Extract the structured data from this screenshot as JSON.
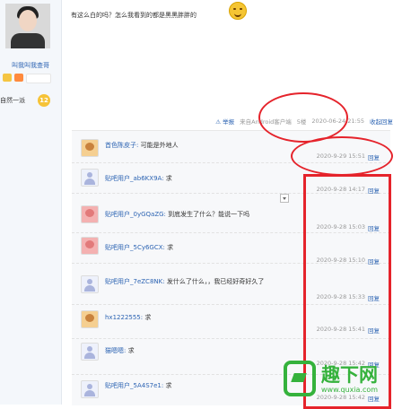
{
  "sidebar": {
    "username": "叫我叫我查哥",
    "level_name": "自然一派",
    "level": "12"
  },
  "post": {
    "text": "有这么白的吗？怎么我看到的都是黑黑胖胖的",
    "report": "⚠ 举报",
    "source": "来自Android客户端",
    "floor": "5楼",
    "time": "2020-06-24 21:55",
    "collapse": "收起回复"
  },
  "comments": [
    {
      "user": "首色陈皮子:",
      "content": "可能是外地人",
      "time": "2020-9-29 15:51",
      "reply": "回复",
      "avatar": "bear"
    },
    {
      "user": "贴吧用户_ab6KX9A:",
      "content": "求",
      "time": "2020-9-28 14:17",
      "reply": "回复",
      "avatar": "default"
    },
    {
      "user": "贴吧用户_0yGQaZG:",
      "content": "到底发生了什么？能说一下吗",
      "time": "2020-9-28 15:03",
      "reply": "回复",
      "avatar": "pink"
    },
    {
      "user": "贴吧用户_5Cy6GCX:",
      "content": "求",
      "time": "2020-9-28 15:10",
      "reply": "回复",
      "avatar": "pink"
    },
    {
      "user": "贴吧用户_7eZC8NK:",
      "content": "发什么了什么，，我已经好奇好久了",
      "time": "2020-9-28 15:33",
      "reply": "回复",
      "avatar": "default"
    },
    {
      "user": "hx1222555:",
      "content": "求",
      "time": "2020-9-28 15:41",
      "reply": "回复",
      "avatar": "bear"
    },
    {
      "user": "猫嗯嗯:",
      "content": "求",
      "time": "2020-9-28 15:42",
      "reply": "回复",
      "avatar": "default"
    },
    {
      "user": "贴吧用户_5A4S7e1:",
      "content": "求",
      "time": "2020-9-28 15:42",
      "reply": "回复",
      "avatar": "default"
    }
  ],
  "watermark": {
    "text": "趣下网",
    "url": "www.quxia.com"
  },
  "colors": {
    "link": "#2d64b3",
    "annotation": "#e5232b",
    "watermark": "#35b23c"
  }
}
